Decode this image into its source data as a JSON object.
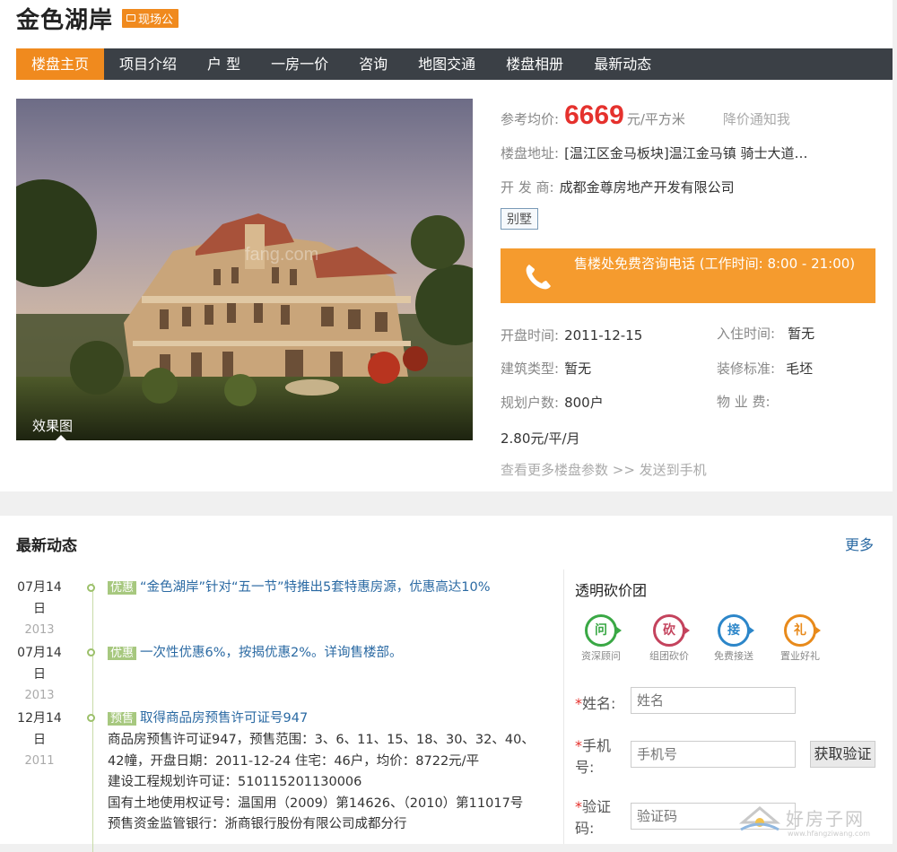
{
  "header": {
    "title": "金色湖岸",
    "badge": "现场公"
  },
  "nav": [
    {
      "label": "楼盘主页",
      "active": true
    },
    {
      "label": "项目介绍"
    },
    {
      "label": "户 型"
    },
    {
      "label": "一房一价"
    },
    {
      "label": "咨询"
    },
    {
      "label": "地图交通"
    },
    {
      "label": "楼盘相册"
    },
    {
      "label": "最新动态"
    }
  ],
  "photo": {
    "caption": "效果图",
    "watermark": "fang.com"
  },
  "info": {
    "price_label": "参考均价:",
    "price": "6669",
    "price_unit": "元/平方米",
    "price_notify": "降价通知我",
    "address_label": "楼盘地址:",
    "address": "[温江区金马板块]温江金马镇 骑士大道…",
    "developer_label": "开 发 商:",
    "developer": "成都金尊房地产开发有限公司",
    "type_tag": "别墅",
    "phone_text": "售楼处免费咨询电话 (工作时间: 8:00 - 21:00)",
    "open_label": "开盘时间:",
    "open_value": "2011-12-15",
    "checkin_label": "入住时间:",
    "checkin_value": "暂无",
    "build_label": "建筑类型:",
    "build_value": "暂无",
    "decor_label": "装修标准:",
    "decor_value": "毛坯",
    "households_label": "规划户数:",
    "households_value": "800户",
    "fee_label": "物 业 费:",
    "fee_value": "2.80元/平/月",
    "more_params": "查看更多楼盘参数 >> 发送到手机"
  },
  "news": {
    "title": "最新动态",
    "more": "更多",
    "items": [
      {
        "day": "07月14",
        "ri": "日",
        "year": "2013",
        "tag": "优惠",
        "title": "“金色湖岸”针对“五一节”特推出5套特惠房源，优惠高达10%"
      },
      {
        "day": "07月14",
        "ri": "日",
        "year": "2013",
        "tag": "优惠",
        "title": "一次性优惠6%，按揭优惠2%。详询售楼部。"
      },
      {
        "day": "12月14",
        "ri": "日",
        "year": "2011",
        "tag": "预售",
        "title": "取得商品房预售许可证号947",
        "body": [
          "商品房预售许可证947，预售范围：3、6、11、15、18、30、32、40、42幢，开盘日期：2011-12-24 住宅：46户，均价：8722元/平",
          "建设工程规划许可证：510115201130006",
          "国有土地使用权证号：温国用（2009）第14626、（2010）第11017号",
          "预售资金监管银行：浙商银行股份有限公司成都分行"
        ]
      }
    ]
  },
  "side": {
    "title": "透明砍价团",
    "features": [
      {
        "glyph": "问",
        "label": "资深顾问",
        "color": "#3aa845"
      },
      {
        "glyph": "砍",
        "label": "组团砍价",
        "color": "#c4435d"
      },
      {
        "glyph": "接",
        "label": "免费接送",
        "color": "#2c86c9"
      },
      {
        "glyph": "礼",
        "label": "置业好礼",
        "color": "#e88a1b"
      }
    ],
    "name_label": "姓名:",
    "name_placeholder": "姓名",
    "phone_label_1": "手机",
    "phone_label_2": "号:",
    "phone_placeholder": "手机号",
    "sms_button": "获取验证",
    "code_label_1": "验证",
    "code_label_2": "码:",
    "code_placeholder": "验证码"
  },
  "watermark": {
    "text": "好房子网",
    "url": "www.hfangziwang.com"
  }
}
